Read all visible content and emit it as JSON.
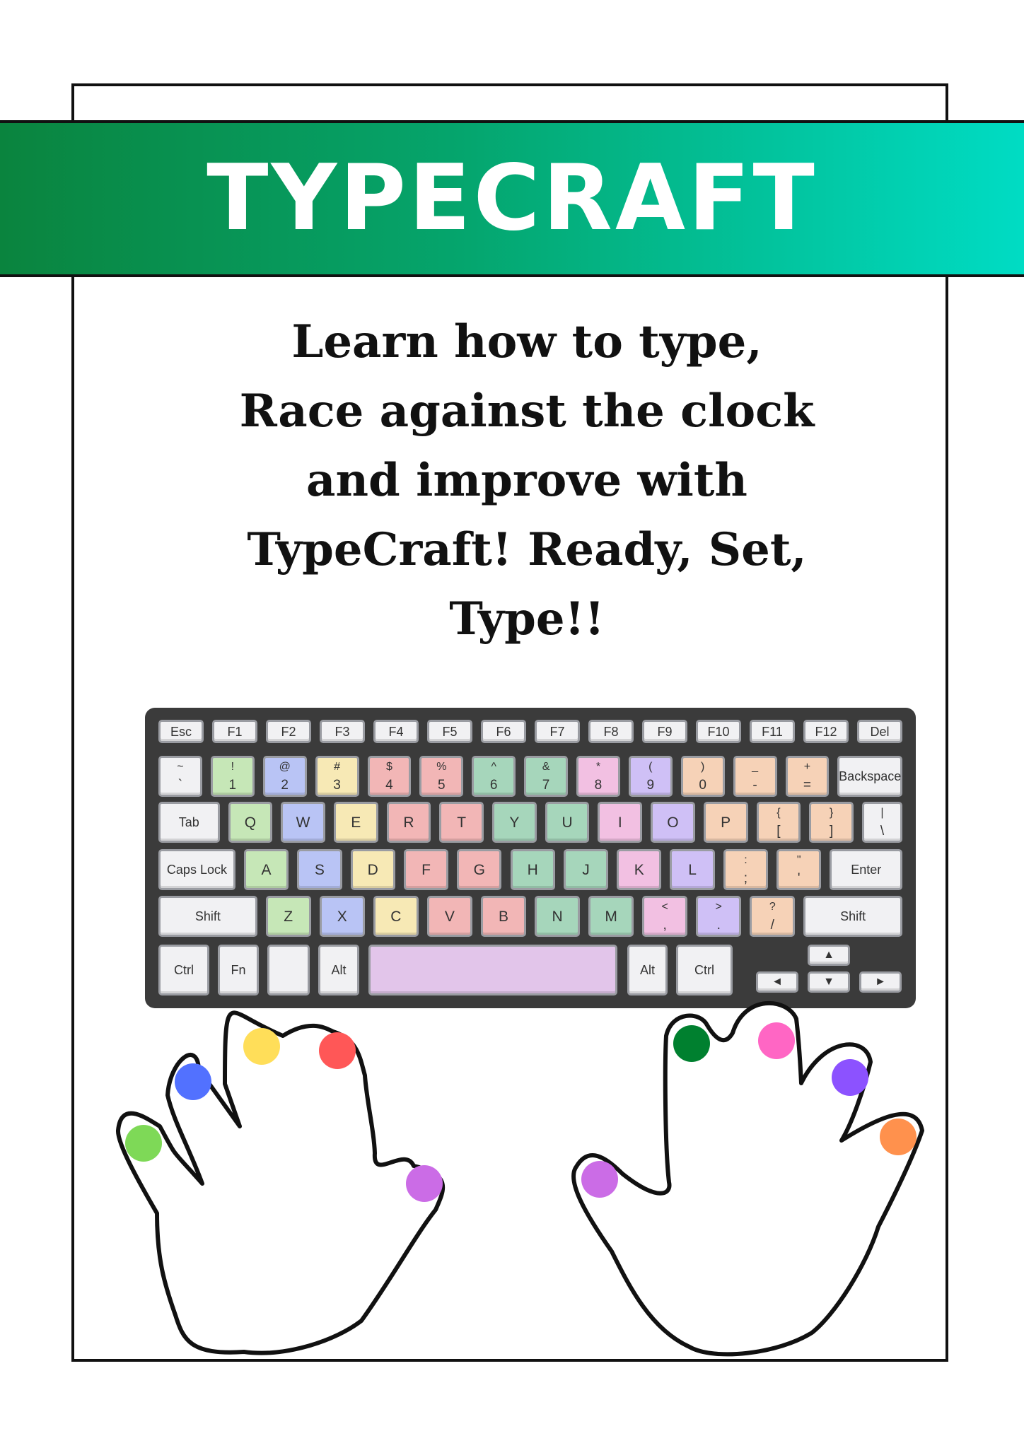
{
  "banner": {
    "title": "TYPECRAFT"
  },
  "tagline": {
    "lines": [
      "Learn how to type,",
      "Race against the clock",
      "and improve with",
      "TypeCraft! Ready, Set,",
      "Type!!"
    ]
  },
  "keyboard": {
    "colors": {
      "green": "#c6e7b7",
      "blue": "#b9c4f5",
      "yellow": "#f7e9b5",
      "red": "#f2b6b6",
      "teal": "#a6d6bb",
      "pink": "#f2c0e2",
      "purple": "#cfc0f6",
      "orange": "#f6d2b7",
      "space": "#e2c5ea",
      "plain": "#f1f1f3"
    },
    "rows": [
      [
        {
          "label": "Esc",
          "color": "plain"
        },
        {
          "label": "F1",
          "color": "plain"
        },
        {
          "label": "F2",
          "color": "plain"
        },
        {
          "label": "F3",
          "color": "plain"
        },
        {
          "label": "F4",
          "color": "plain"
        },
        {
          "label": "F5",
          "color": "plain"
        },
        {
          "label": "F6",
          "color": "plain"
        },
        {
          "label": "F7",
          "color": "plain"
        },
        {
          "label": "F8",
          "color": "plain"
        },
        {
          "label": "F9",
          "color": "plain"
        },
        {
          "label": "F10",
          "color": "plain"
        },
        {
          "label": "F11",
          "color": "plain"
        },
        {
          "label": "F12",
          "color": "plain"
        },
        {
          "label": "Del",
          "color": "plain"
        }
      ],
      [
        {
          "top": "~",
          "bottom": "`",
          "color": "plain"
        },
        {
          "top": "!",
          "bottom": "1",
          "color": "green"
        },
        {
          "top": "@",
          "bottom": "2",
          "color": "blue"
        },
        {
          "top": "#",
          "bottom": "3",
          "color": "yellow"
        },
        {
          "top": "$",
          "bottom": "4",
          "color": "red"
        },
        {
          "top": "%",
          "bottom": "5",
          "color": "red"
        },
        {
          "top": "^",
          "bottom": "6",
          "color": "teal"
        },
        {
          "top": "&",
          "bottom": "7",
          "color": "teal"
        },
        {
          "top": "*",
          "bottom": "8",
          "color": "pink"
        },
        {
          "top": "(",
          "bottom": "9",
          "color": "purple"
        },
        {
          "top": ")",
          "bottom": "0",
          "color": "orange"
        },
        {
          "top": "_",
          "bottom": "-",
          "color": "orange"
        },
        {
          "top": "+",
          "bottom": "=",
          "color": "orange"
        },
        {
          "label": "Backspace",
          "color": "plain"
        }
      ],
      [
        {
          "label": "Tab",
          "color": "plain"
        },
        {
          "label": "Q",
          "color": "green"
        },
        {
          "label": "W",
          "color": "blue"
        },
        {
          "label": "E",
          "color": "yellow"
        },
        {
          "label": "R",
          "color": "red"
        },
        {
          "label": "T",
          "color": "red"
        },
        {
          "label": "Y",
          "color": "teal"
        },
        {
          "label": "U",
          "color": "teal"
        },
        {
          "label": "I",
          "color": "pink"
        },
        {
          "label": "O",
          "color": "purple"
        },
        {
          "label": "P",
          "color": "orange"
        },
        {
          "top": "{",
          "bottom": "[",
          "color": "orange"
        },
        {
          "top": "}",
          "bottom": "]",
          "color": "orange"
        },
        {
          "top": "|",
          "bottom": "\\",
          "color": "plain"
        }
      ],
      [
        {
          "label": "Caps Lock",
          "color": "plain"
        },
        {
          "label": "A",
          "color": "green"
        },
        {
          "label": "S",
          "color": "blue"
        },
        {
          "label": "D",
          "color": "yellow"
        },
        {
          "label": "F",
          "color": "red"
        },
        {
          "label": "G",
          "color": "red"
        },
        {
          "label": "H",
          "color": "teal"
        },
        {
          "label": "J",
          "color": "teal"
        },
        {
          "label": "K",
          "color": "pink"
        },
        {
          "label": "L",
          "color": "purple"
        },
        {
          "top": ":",
          "bottom": ";",
          "color": "orange"
        },
        {
          "top": "\"",
          "bottom": "'",
          "color": "orange"
        },
        {
          "label": "Enter",
          "color": "plain"
        }
      ],
      [
        {
          "label": "Shift",
          "color": "plain"
        },
        {
          "label": "Z",
          "color": "green"
        },
        {
          "label": "X",
          "color": "blue"
        },
        {
          "label": "C",
          "color": "yellow"
        },
        {
          "label": "V",
          "color": "red"
        },
        {
          "label": "B",
          "color": "red"
        },
        {
          "label": "N",
          "color": "teal"
        },
        {
          "label": "M",
          "color": "teal"
        },
        {
          "top": "<",
          "bottom": ",",
          "color": "pink"
        },
        {
          "top": ">",
          "bottom": ".",
          "color": "purple"
        },
        {
          "top": "?",
          "bottom": "/",
          "color": "orange"
        },
        {
          "label": "Shift",
          "color": "plain"
        }
      ],
      [
        {
          "label": "Ctrl",
          "color": "plain"
        },
        {
          "label": "Fn",
          "color": "plain"
        },
        {
          "label": "",
          "color": "plain"
        },
        {
          "label": "Alt",
          "color": "plain"
        },
        {
          "label": "",
          "color": "space"
        },
        {
          "label": "Alt",
          "color": "plain"
        },
        {
          "label": "Ctrl",
          "color": "plain"
        },
        {
          "label": "▲",
          "color": "plain"
        },
        {
          "label": "◄",
          "color": "plain"
        },
        {
          "label": "▼",
          "color": "plain"
        },
        {
          "label": "►",
          "color": "plain"
        }
      ]
    ]
  },
  "hands": {
    "left": {
      "finger_dots": [
        {
          "finger": "pinky",
          "color": "#7ed957"
        },
        {
          "finger": "ring",
          "color": "#5271ff"
        },
        {
          "finger": "middle",
          "color": "#ffde59"
        },
        {
          "finger": "index",
          "color": "#ff5757"
        },
        {
          "finger": "thumb",
          "color": "#cb6ce6"
        }
      ]
    },
    "right": {
      "finger_dots": [
        {
          "finger": "thumb",
          "color": "#cb6ce6"
        },
        {
          "finger": "index",
          "color": "#00802f"
        },
        {
          "finger": "middle",
          "color": "#ff66c4"
        },
        {
          "finger": "ring",
          "color": "#8c52ff"
        },
        {
          "finger": "pinky",
          "color": "#ff914d"
        }
      ]
    }
  }
}
